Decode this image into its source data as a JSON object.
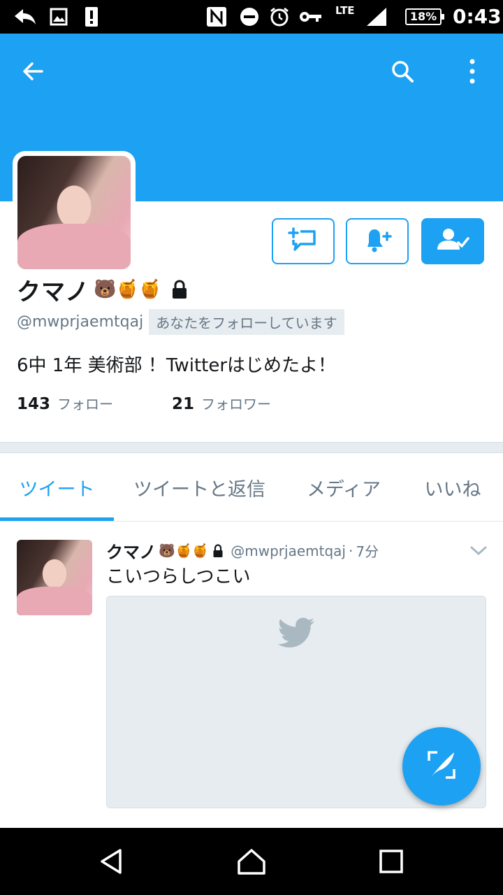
{
  "status_bar": {
    "network": "LTE",
    "battery": "18%",
    "time": "0:43"
  },
  "toolbar": {
    "back_icon": "arrow-left-icon",
    "search_icon": "search-icon",
    "more_icon": "more-vertical-icon"
  },
  "profile": {
    "display_name": "クマノ",
    "name_emojis": "🐻🍯🍯",
    "handle": "@mwprjaemtqaj",
    "follows_you": "あなたをフォローしています",
    "bio": "6中 1年 美術部 ！Twitterはじめたよ！",
    "following_count": "143",
    "following_label": "フォロー",
    "followers_count": "21",
    "followers_label": "フォロワー",
    "protected": true
  },
  "actions": {
    "message_icon": "direct-message-icon",
    "notify_icon": "bell-plus-icon",
    "following_icon": "user-check-icon"
  },
  "tabs": [
    {
      "label": "ツイート",
      "active": true
    },
    {
      "label": "ツイートと返信",
      "active": false
    },
    {
      "label": "メディア",
      "active": false
    },
    {
      "label": "いいね",
      "active": false
    }
  ],
  "tweet": {
    "name": "クマノ",
    "emojis": "🐻🍯🍯",
    "handle": "@mwprjaemtqaj",
    "separator": "·",
    "time": "7分",
    "text": "こいつらしつこい"
  },
  "colors": {
    "brand": "#1da1f2",
    "secondary_text": "#657786",
    "background_gray": "#e6ecf0"
  }
}
